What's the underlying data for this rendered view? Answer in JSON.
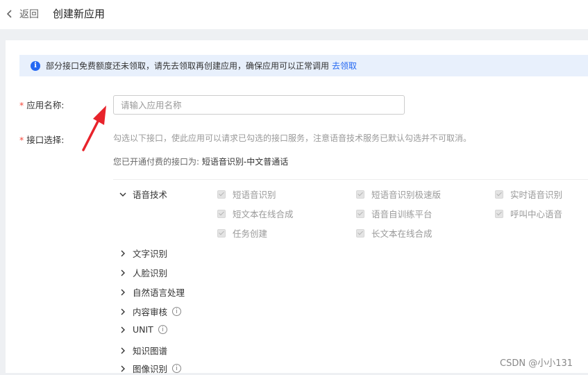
{
  "header": {
    "back_label": "返回",
    "title": "创建新应用"
  },
  "notice": {
    "text": "部分接口免费额度还未领取，请先去领取再创建应用，确保应用可以正常调用",
    "link": "去领取"
  },
  "form": {
    "required_mark": "*",
    "app_name": {
      "label": "应用名称:",
      "placeholder": "请输入应用名称",
      "value": ""
    },
    "api_select": {
      "label": "接口选择:",
      "hint": "勾选以下接口，使此应用可以请求已勾选的接口服务，注意语音技术服务已默认勾选并不可取消。",
      "paid_prefix": "您已开通付费的接口为:",
      "paid_value": "短语音识别-中文普通话"
    }
  },
  "categories": [
    {
      "label": "语音技术",
      "expanded": true,
      "info": false
    },
    {
      "label": "文字识别",
      "expanded": false,
      "info": false
    },
    {
      "label": "人脸识别",
      "expanded": false,
      "info": false
    },
    {
      "label": "自然语言处理",
      "expanded": false,
      "info": false
    },
    {
      "label": "内容审核",
      "expanded": false,
      "info": true
    },
    {
      "label": "UNIT",
      "expanded": false,
      "info": true
    },
    {
      "label": "知识图谱",
      "expanded": false,
      "info": false
    },
    {
      "label": "图像识别",
      "expanded": false,
      "info": true
    }
  ],
  "speech_services": [
    {
      "label": "短语音识别",
      "checked": true,
      "disabled": true
    },
    {
      "label": "短语音识别极速版",
      "checked": true,
      "disabled": true
    },
    {
      "label": "实时语音识别",
      "checked": true,
      "disabled": true
    },
    {
      "label": "短文本在线合成",
      "checked": true,
      "disabled": true
    },
    {
      "label": "语音自训练平台",
      "checked": true,
      "disabled": true
    },
    {
      "label": "呼叫中心语音",
      "checked": true,
      "disabled": true
    },
    {
      "label": "任务创建",
      "checked": true,
      "disabled": true
    },
    {
      "label": "长文本在线合成",
      "checked": true,
      "disabled": true
    }
  ],
  "info_glyph": "i",
  "watermark": "CSDN @小小131",
  "colors": {
    "accent": "#2468f2",
    "required": "#f5483b",
    "arrow": "#e8232b",
    "notice_bg": "#e8f0fc"
  }
}
